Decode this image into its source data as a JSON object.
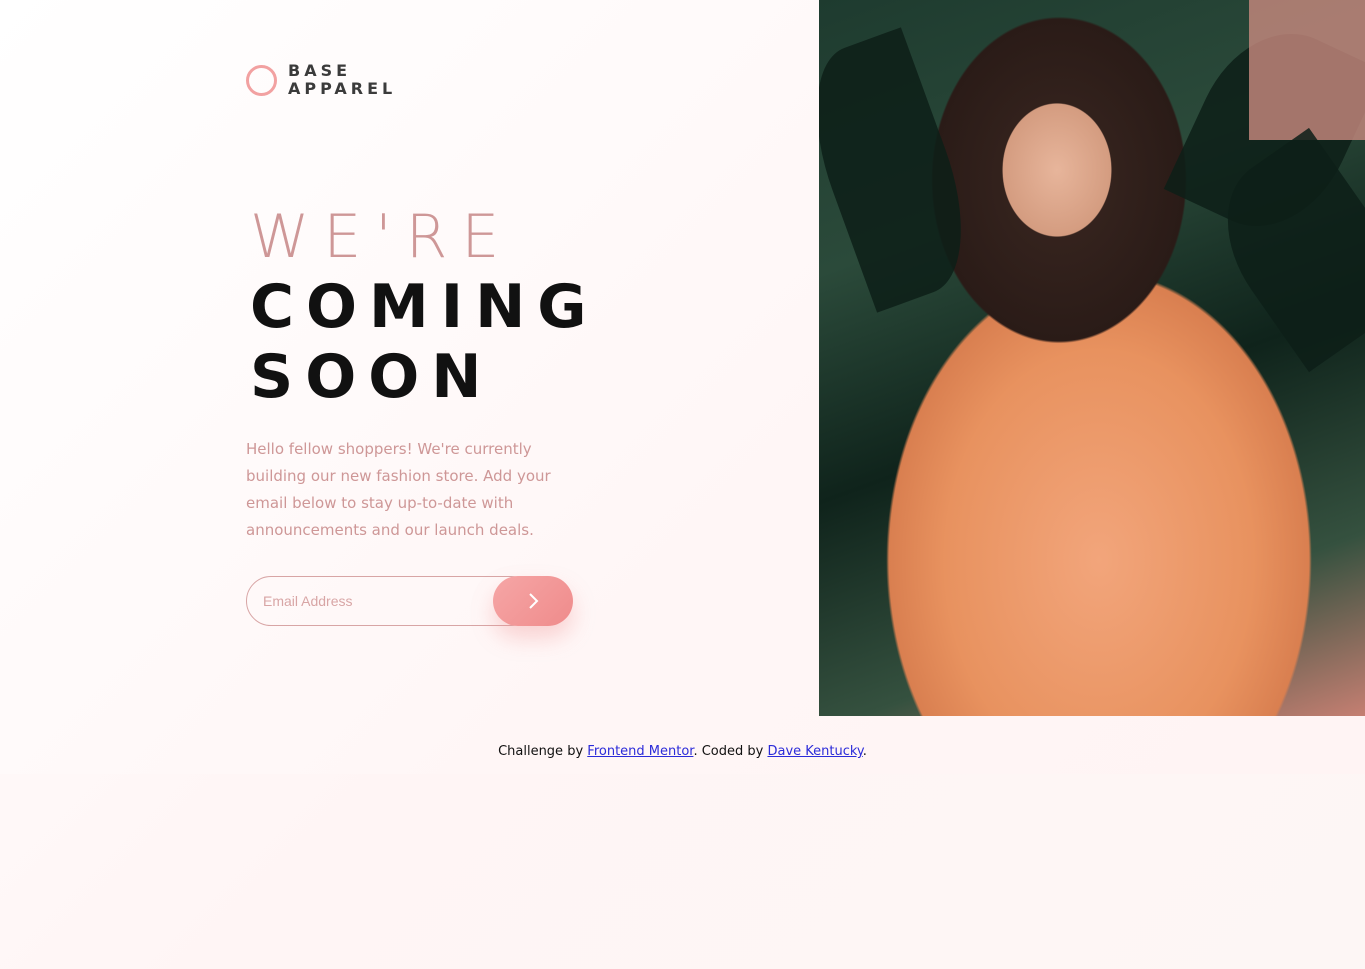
{
  "brand": {
    "line1": "BASE",
    "line2": "APPAREL",
    "accent_color": "#f2a1a1"
  },
  "headline": {
    "line1": "WE'RE",
    "line2": "COMING",
    "line3": "SOON"
  },
  "description": "Hello fellow shoppers! We're currently building our new fashion store. Add your email below to stay up-to-date with announcements and our launch deals.",
  "form": {
    "email_placeholder": "Email Address",
    "submit_icon": "chevron-right-icon"
  },
  "hero": {
    "image": "woman-in-peach-shirt-photo"
  },
  "footer": {
    "prefix": "Challenge by ",
    "link1": "Frontend Mentor",
    "middle": ". Coded by ",
    "link2": "Dave Kentucky",
    "suffix": "."
  },
  "colors": {
    "text_pink": "#ce9797",
    "heading_dark": "#111111",
    "button_gradient_start": "#f6a6a6",
    "button_gradient_end": "#ef8b8b",
    "link": "#2b2bd9"
  }
}
